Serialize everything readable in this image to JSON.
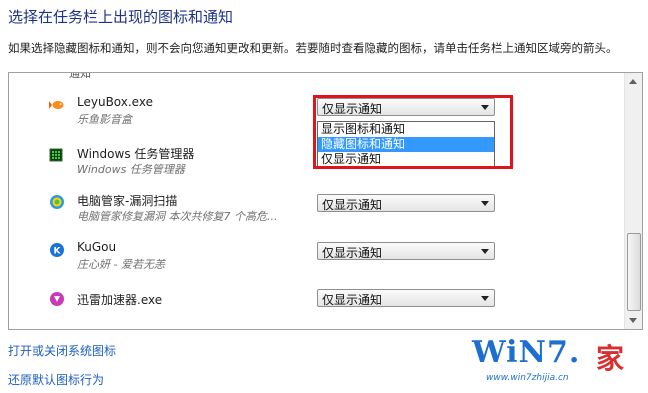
{
  "header": {
    "title": "选择在任务栏上出现的图标和通知",
    "description": "如果选择隐藏图标和通知，则不会向您通知更改和更新。若要随时查看隐藏的图标，请单击任务栏上通知区域旁的箭头。"
  },
  "list": {
    "cut_top_text": "通知",
    "rows": [
      {
        "name": "LeyuBox.exe",
        "subtitle": "乐鱼影音盒",
        "behavior": "仅显示通知",
        "icon": "fish-icon"
      },
      {
        "name": "Windows 任务管理器",
        "subtitle": "Windows 任务管理器",
        "behavior": "仅显示通知",
        "icon": "task-manager-icon"
      },
      {
        "name": "电脑管家-漏洞扫描",
        "subtitle": "电脑管家修复漏洞  本次共修复7 个高危...",
        "behavior": "仅显示通知",
        "icon": "pc-manager-icon"
      },
      {
        "name": "KuGou",
        "subtitle": "庄心妍 - 爱若无恙",
        "behavior": "仅显示通知",
        "icon": "kugou-icon"
      },
      {
        "name": "迅雷加速器.exe",
        "subtitle": "",
        "behavior": "仅显示通知",
        "icon": "xunlei-icon"
      }
    ],
    "dropdown_options": [
      "显示图标和通知",
      "隐藏图标和通知",
      "仅显示通知"
    ],
    "dropdown_selected_index": 1
  },
  "links": {
    "toggle_system_icons": "打开或关闭系统图标",
    "restore_defaults": "还原默认图标行为"
  },
  "watermark": {
    "brand": "WiN7.",
    "home": "家",
    "url": "www.win7zhijia.cn"
  },
  "colors": {
    "title": "#1e3287",
    "link": "#1e5fbd",
    "highlight": "#e0141b",
    "selection": "#3399ff"
  }
}
